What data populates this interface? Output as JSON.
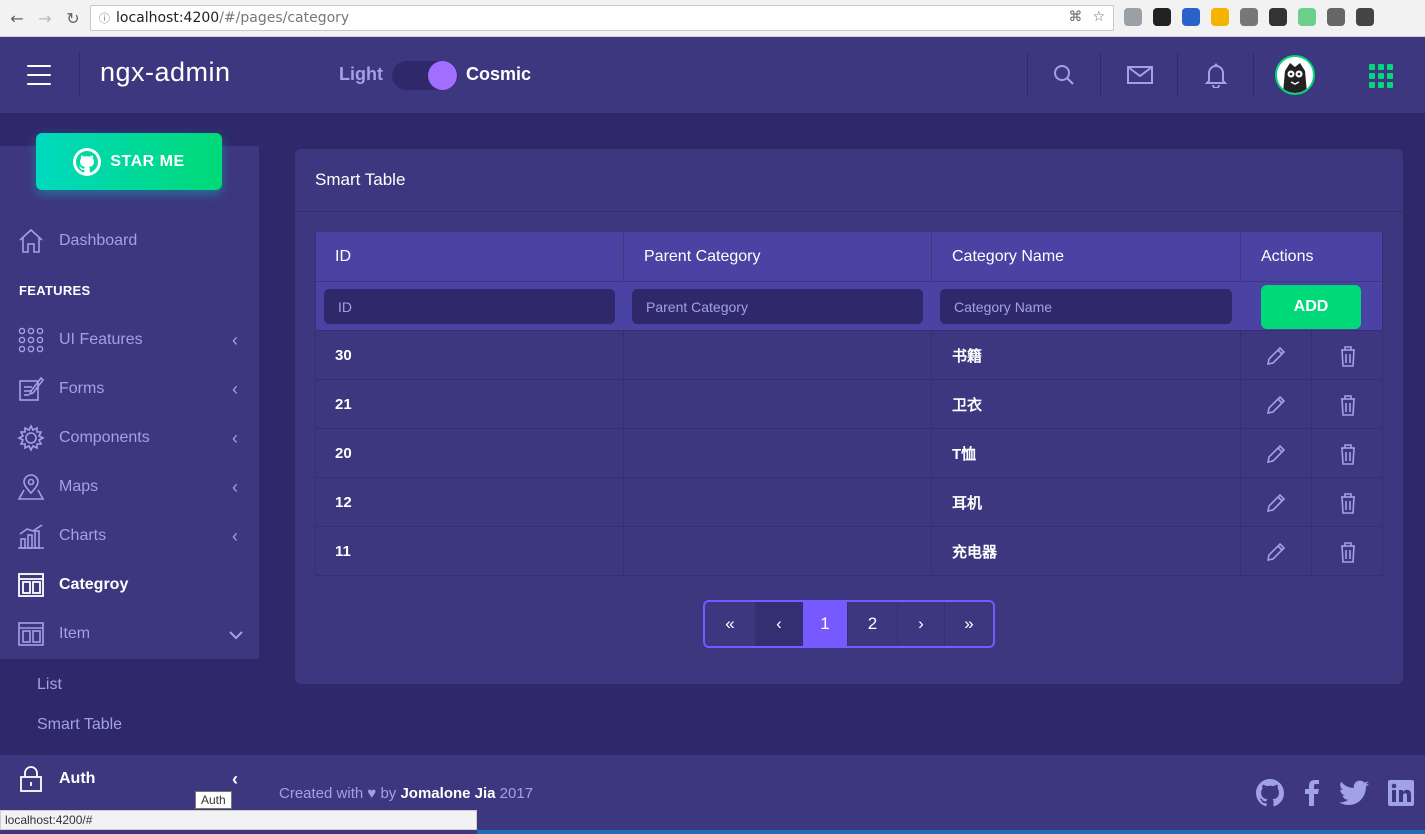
{
  "browser": {
    "url_host": "localhost:4200",
    "url_path": "/#/pages/category"
  },
  "header": {
    "logo": "ngx-admin",
    "theme_light": "Light",
    "theme_dark": "Cosmic"
  },
  "sidebar": {
    "star_button": "STAR ME",
    "features_label": "FEATURES",
    "items": [
      {
        "label": "Dashboard",
        "icon": "home-icon"
      },
      {
        "label": "UI Features",
        "icon": "keypad-icon"
      },
      {
        "label": "Forms",
        "icon": "compose-icon"
      },
      {
        "label": "Components",
        "icon": "gear-icon"
      },
      {
        "label": "Maps",
        "icon": "location-icon"
      },
      {
        "label": "Charts",
        "icon": "bar-chart-icon"
      },
      {
        "label": "Categroy",
        "icon": "layout-icon"
      },
      {
        "label": "Item",
        "icon": "layout-icon"
      },
      {
        "label": "Auth",
        "icon": "lock-icon"
      }
    ],
    "sub_items": [
      "List",
      "Smart Table"
    ]
  },
  "card": {
    "title": "Smart Table"
  },
  "table": {
    "columns": [
      "ID",
      "Parent Category",
      "Category Name",
      "Actions"
    ],
    "filters": {
      "id_placeholder": "ID",
      "parent_placeholder": "Parent Category",
      "name_placeholder": "Category Name"
    },
    "add_label": "ADD",
    "rows": [
      {
        "id": "30",
        "parent": "",
        "name": "书籍"
      },
      {
        "id": "21",
        "parent": "",
        "name": "卫衣"
      },
      {
        "id": "20",
        "parent": "",
        "name": "T恤"
      },
      {
        "id": "12",
        "parent": "",
        "name": "耳机"
      },
      {
        "id": "11",
        "parent": "",
        "name": "充电器"
      }
    ]
  },
  "pagination": {
    "first": "«",
    "prev": "‹",
    "pages": [
      "1",
      "2"
    ],
    "current": "1",
    "next": "›",
    "last": "»"
  },
  "footer": {
    "prefix": "Created with ♥ by ",
    "author": "Jomalone Jia",
    "year": " 2017"
  },
  "status": {
    "link": "localhost:4200/#",
    "tooltip": "Auth"
  },
  "colors": {
    "primary": "#7659ff",
    "success": "#00d977",
    "header_bg": "#3d3780",
    "page_bg": "#2f296b"
  }
}
